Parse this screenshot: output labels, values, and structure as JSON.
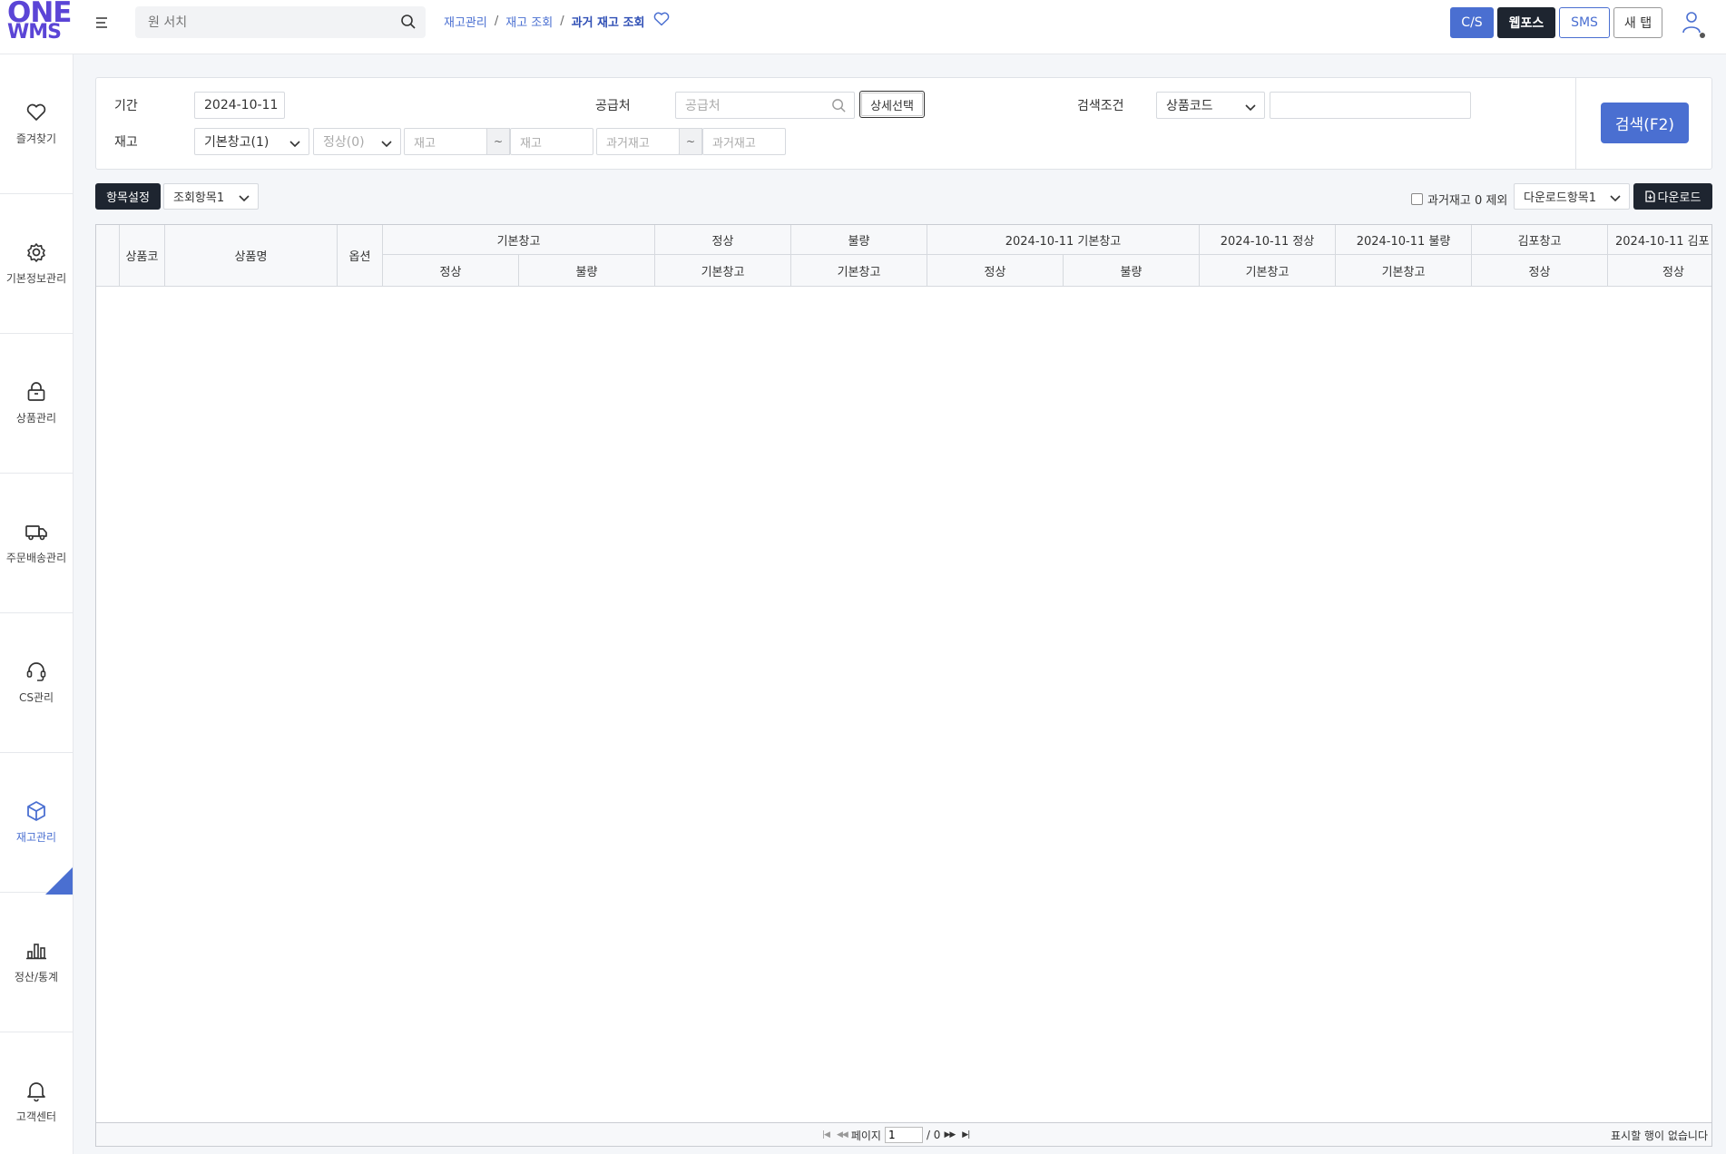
{
  "header": {
    "logo_line1": "ONE",
    "logo_line2": "WMS",
    "search_placeholder": "원 서치",
    "breadcrumb": [
      "재고관리",
      "재고 조회",
      "과거 재고 조회"
    ],
    "buttons": {
      "cs": "C/S",
      "webpos": "웹포스",
      "sms": "SMS",
      "new_tab": "새 탭"
    }
  },
  "sidebar": {
    "items": [
      {
        "label": "즐겨찾기",
        "icon": "heart-icon"
      },
      {
        "label": "기본정보관리",
        "icon": "gear-icon"
      },
      {
        "label": "상품관리",
        "icon": "lock-bag-icon"
      },
      {
        "label": "주문배송관리",
        "icon": "truck-icon"
      },
      {
        "label": "CS관리",
        "icon": "headset-icon"
      },
      {
        "label": "재고관리",
        "icon": "box-icon",
        "active": true
      },
      {
        "label": "정산/통계",
        "icon": "bar-chart-icon"
      },
      {
        "label": "고객센터",
        "icon": "bell-icon"
      }
    ]
  },
  "filter": {
    "period_label": "기간",
    "period_value": "2024-10-11",
    "supplier_label": "공급처",
    "supplier_placeholder": "공급처",
    "detail_select": "상세선택",
    "cond_label": "검색조건",
    "cond_value": "상품코드",
    "cond_input_value": "",
    "stock_label": "재고",
    "warehouse_value": "기본창고(1)",
    "status_value": "정상(0)",
    "stock_from_placeholder": "재고",
    "stock_to_placeholder": "재고",
    "past_from_placeholder": "과거재고",
    "past_to_placeholder": "과거재고",
    "tilde": "~",
    "search_button": "검색(F2)"
  },
  "toolbar": {
    "column_settings": "항목설정",
    "view_items": "조회항목1",
    "exclude_zero_label": "과거재고 0 제외",
    "exclude_zero_checked": false,
    "download_items": "다운로드항목1",
    "download": "다운로드"
  },
  "grid": {
    "fixed_headers": [
      "상품코",
      "상품명",
      "옵션"
    ],
    "group_headers": [
      "기본창고",
      "정상",
      "불량",
      "2024-10-11 기본창고",
      "2024-10-11 정상",
      "2024-10-11 불량",
      "김포창고",
      "2024-10-11 김포"
    ],
    "sub_headers": [
      "정상",
      "불량",
      "기본창고",
      "기본창고",
      "정상",
      "불량",
      "기본창고",
      "기본창고",
      "정상",
      "정상"
    ],
    "rows": [],
    "footer": {
      "page_label": "페이지",
      "page_value": "1",
      "page_total": "/ 0",
      "no_rows": "표시할 행이 없습니다"
    }
  }
}
